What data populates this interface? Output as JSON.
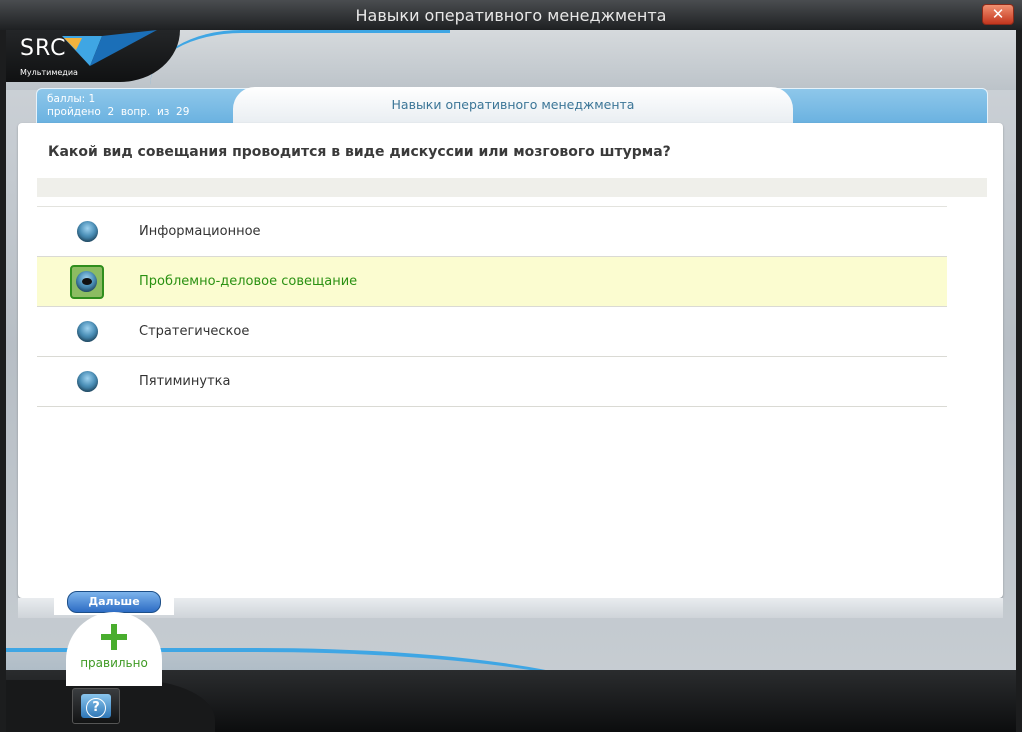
{
  "window": {
    "title": "Навыки оперативного менеджмента",
    "close_glyph": "✕"
  },
  "logo": {
    "text": "SRC",
    "subtitle": "Мультимедиа",
    "icon": "src-logo-icon"
  },
  "info": {
    "score_line": "баллы: 1",
    "progress_line": "пройдено  2  вопр.  из  29"
  },
  "course_title": "Навыки оперативного менеджмента",
  "question": "Какой вид совещания проводится в виде дискуссии или мозгового штурма?",
  "answers": [
    {
      "label": "Информационное",
      "selected": false
    },
    {
      "label": "Проблемно-деловое совещание",
      "selected": true
    },
    {
      "label": "Стратегическое",
      "selected": false
    },
    {
      "label": "Пятиминутка",
      "selected": false
    }
  ],
  "next_button": "Дальше",
  "result": {
    "icon": "plus-icon",
    "label": "правильно"
  },
  "help_button": {
    "icon": "help-icon",
    "glyph": "?"
  },
  "colors": {
    "accent_blue": "#3fa6e4",
    "correct_green": "#2a9112",
    "selected_row": "#fbfcd0"
  }
}
